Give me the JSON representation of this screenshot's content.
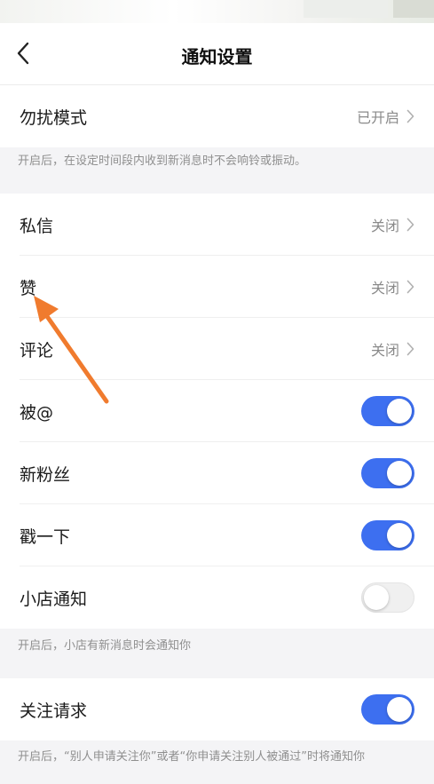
{
  "nav": {
    "title": "通知设置"
  },
  "dnd": {
    "label": "勿扰模式",
    "value": "已开启",
    "hint": "开启后，在设定时间段内收到新消息时不会响铃或振动。"
  },
  "items": [
    {
      "label": "私信",
      "value": "关闭"
    },
    {
      "label": "赞",
      "value": "关闭"
    },
    {
      "label": "评论",
      "value": "关闭"
    }
  ],
  "toggles": [
    {
      "label": "被@",
      "on": true
    },
    {
      "label": "新粉丝",
      "on": true
    },
    {
      "label": "戳一下",
      "on": true
    },
    {
      "label": "小店通知",
      "on": false
    }
  ],
  "shop_hint": "开启后，小店有新消息时会通知你",
  "follow": {
    "label": "关注请求",
    "on": true
  },
  "follow_hint": "开启后，“别人申请关注你”或者“你申请关注别人被通过”时将通知你",
  "colors": {
    "accent": "#3d6ff0",
    "annotation": "#f07b2e"
  }
}
